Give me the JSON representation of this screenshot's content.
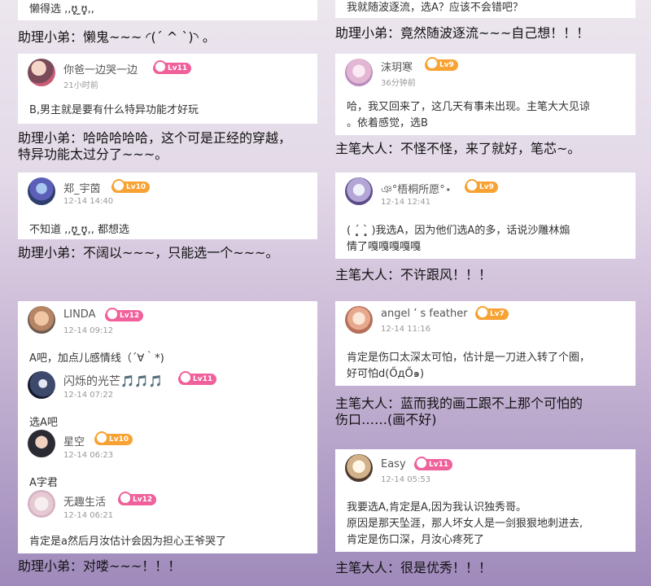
{
  "colors": {
    "pink_badge": "#f0609a",
    "orange_badge": "#f7a233"
  },
  "left": {
    "top_snippet": "懒得选 ,,ʊ̥̥̥ ̫ʊ̥̥̥,,",
    "reply1": "助理小弟：懒鬼~~~ ◜(ˊ ^ ˋ)◝ 。",
    "c1": {
      "name": "你爸一边哭一边",
      "time": "21小时前",
      "lv": "Lv11",
      "text": "B,男主就是要有什么特异功能才好玩"
    },
    "reply2": "助理小弟：哈哈哈哈哈，这个可是正经的穿越，\n特异功能太过分了~~~。",
    "c2": {
      "name": "郑_宇茵",
      "time": "12-14 14:40",
      "lv": "Lv10",
      "text": "不知道 ,,ʊ̥̥̥ ̫ʊ̥̥̥,, 都想选"
    },
    "reply3": "助理小弟：不阔以~~~，只能选一个~~~。",
    "thread": [
      {
        "name": "LINDA",
        "time": "12-14 09:12",
        "lv": "Lv12",
        "text": "A吧，加点儿感情线（´∀｀*)"
      },
      {
        "name": "闪烁的光芒🎵🎵🎵",
        "time": "12-14 07:22",
        "lv": "Lv11",
        "text": "选A吧"
      },
      {
        "name": "星空",
        "time": "12-14 06:23",
        "lv": "Lv10",
        "text": "A字君"
      },
      {
        "name": "无趣生活",
        "time": "12-14 06:21",
        "lv": "Lv12",
        "text": "肯定是a然后月汝估计会因为担心王爷哭了"
      }
    ],
    "reply4": "助理小弟：对喽~~~！！！"
  },
  "right": {
    "top_snippet": "我就随波逐流，选A？应该不会错吧？",
    "reply1": "助理小弟：竟然随波逐流~~~自己想！！！",
    "c1": {
      "name": "沫玥寒",
      "time": "36分钟前",
      "lv": "Lv9",
      "text": "哈，我又回来了，这几天有事未出现。主笔大大见谅\n。依着感觉，选B"
    },
    "reply2": "主笔大人：不怪不怪，来了就好，笔芯~。",
    "c2": {
      "name": "ঞ°梧桐所愿°⋆",
      "time": "12-14 12:41",
      "lv": "Lv9",
      "text": "( ˊ̥̥̥̥̥ ˋ̥̥̥̥̥ )我选A，因为他们选A的多，话说沙雕林煽\n情了嘎嘎嘎嘎嘎"
    },
    "reply3": "主笔大人：不许跟风！！！",
    "c3": {
      "name": "angel ’ s feather",
      "time": "12-14 11:16",
      "lv": "Lv7",
      "text": "肯定是伤口太深太可怕，估计是一刀进入转了个圈，\n好可怕d(ŐдŐ๑)"
    },
    "reply4": "主笔大人：蓝而我的画工跟不上那个可怕的\n伤口……(画不好)",
    "c4": {
      "name": "Easy",
      "time": "12-14 05:53",
      "lv": "Lv11",
      "text": "我要选A,肯定是A,因为我认识独秀哥。\n原因是那天坠涯，那人坏女人是一剑狠狠地刺进去,\n肯定是伤口深，月汝心疼死了"
    },
    "reply5": "主笔大人：很是优秀！！！"
  }
}
